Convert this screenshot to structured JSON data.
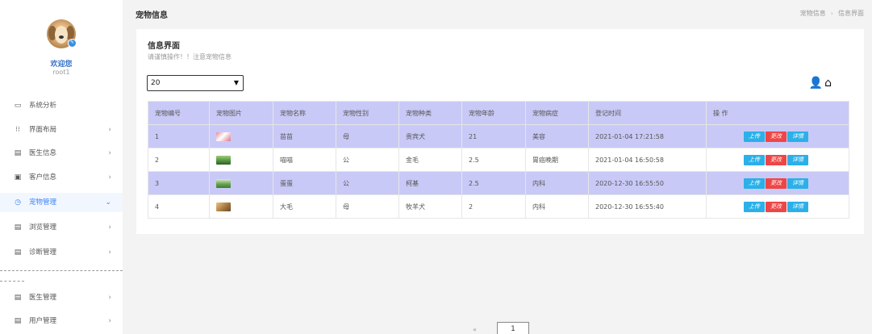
{
  "header": {
    "page_title": "宠物信息",
    "breadcrumb": [
      "宠物信息",
      "信息界面"
    ],
    "breadcrumb_sep": "›"
  },
  "sidebar": {
    "welcome": "欢迎您",
    "username": "root1",
    "items": [
      {
        "label": "系统分析",
        "icon": "monitor-icon",
        "glyph": "▭",
        "arrow": ""
      },
      {
        "label": "界面布局",
        "icon": "grid-icon",
        "glyph": "⁝⁝",
        "arrow": "›"
      },
      {
        "label": "医生信息",
        "icon": "calendar-icon",
        "glyph": "▤",
        "arrow": "›"
      },
      {
        "label": "客户信息",
        "icon": "card-icon",
        "glyph": "▣",
        "arrow": "›"
      },
      {
        "label": "宠物管理",
        "icon": "clock-icon",
        "glyph": "◷",
        "arrow": "⌄"
      },
      {
        "label": "浏览管理",
        "icon": "document-icon",
        "glyph": "▤",
        "arrow": "›"
      },
      {
        "label": "诊断管理",
        "icon": "document-icon",
        "glyph": "▤",
        "arrow": "›"
      },
      {
        "label": "医生管理",
        "icon": "document-icon",
        "glyph": "▤",
        "arrow": "›"
      },
      {
        "label": "用户管理",
        "icon": "document-icon",
        "glyph": "▤",
        "arrow": "›"
      }
    ]
  },
  "card": {
    "title": "信息界面",
    "subtitle": "请谨慎操作！！注意宠物信息",
    "page_size": "20",
    "select_caret": "▼",
    "tool_icons": {
      "user": "👤",
      "home": "⌂"
    }
  },
  "table": {
    "columns": [
      "宠物编号",
      "宠物图片",
      "宠物名称",
      "宠物性别",
      "宠物种类",
      "宠物年龄",
      "宠物病症",
      "登记时间",
      "操 作"
    ],
    "rows": [
      {
        "id": "1",
        "name": "苗苗",
        "gender": "母",
        "type": "贵宾犬",
        "age": "21",
        "symptom": "美容",
        "time": "2021-01-04 17:21:58",
        "thumb": "#d9768a"
      },
      {
        "id": "2",
        "name": "喵喵",
        "gender": "公",
        "type": "金毛",
        "age": "2.5",
        "symptom": "胃癌晚期",
        "time": "2021-01-04 16:50:58",
        "thumb": "#4f8f3d"
      },
      {
        "id": "3",
        "name": "蛋蛋",
        "gender": "公",
        "type": "柯基",
        "age": "2.5",
        "symptom": "内科",
        "time": "2020-12-30 16:55:50",
        "thumb": "#6aa34e"
      },
      {
        "id": "4",
        "name": "大毛",
        "gender": "母",
        "type": "牧羊犬",
        "age": "2",
        "symptom": "内科",
        "time": "2020-12-30 16:55:40",
        "thumb": "#a77a3f"
      }
    ],
    "actions": {
      "upload": "上传",
      "update": "更改",
      "detail": "详情"
    }
  },
  "pager": {
    "prev": "«",
    "current": "1"
  },
  "colors": {
    "accent": "#3b82f6",
    "header_row": "#c9c9f7",
    "btn_blue": "#2bb0e8",
    "btn_red": "#ee4646"
  }
}
